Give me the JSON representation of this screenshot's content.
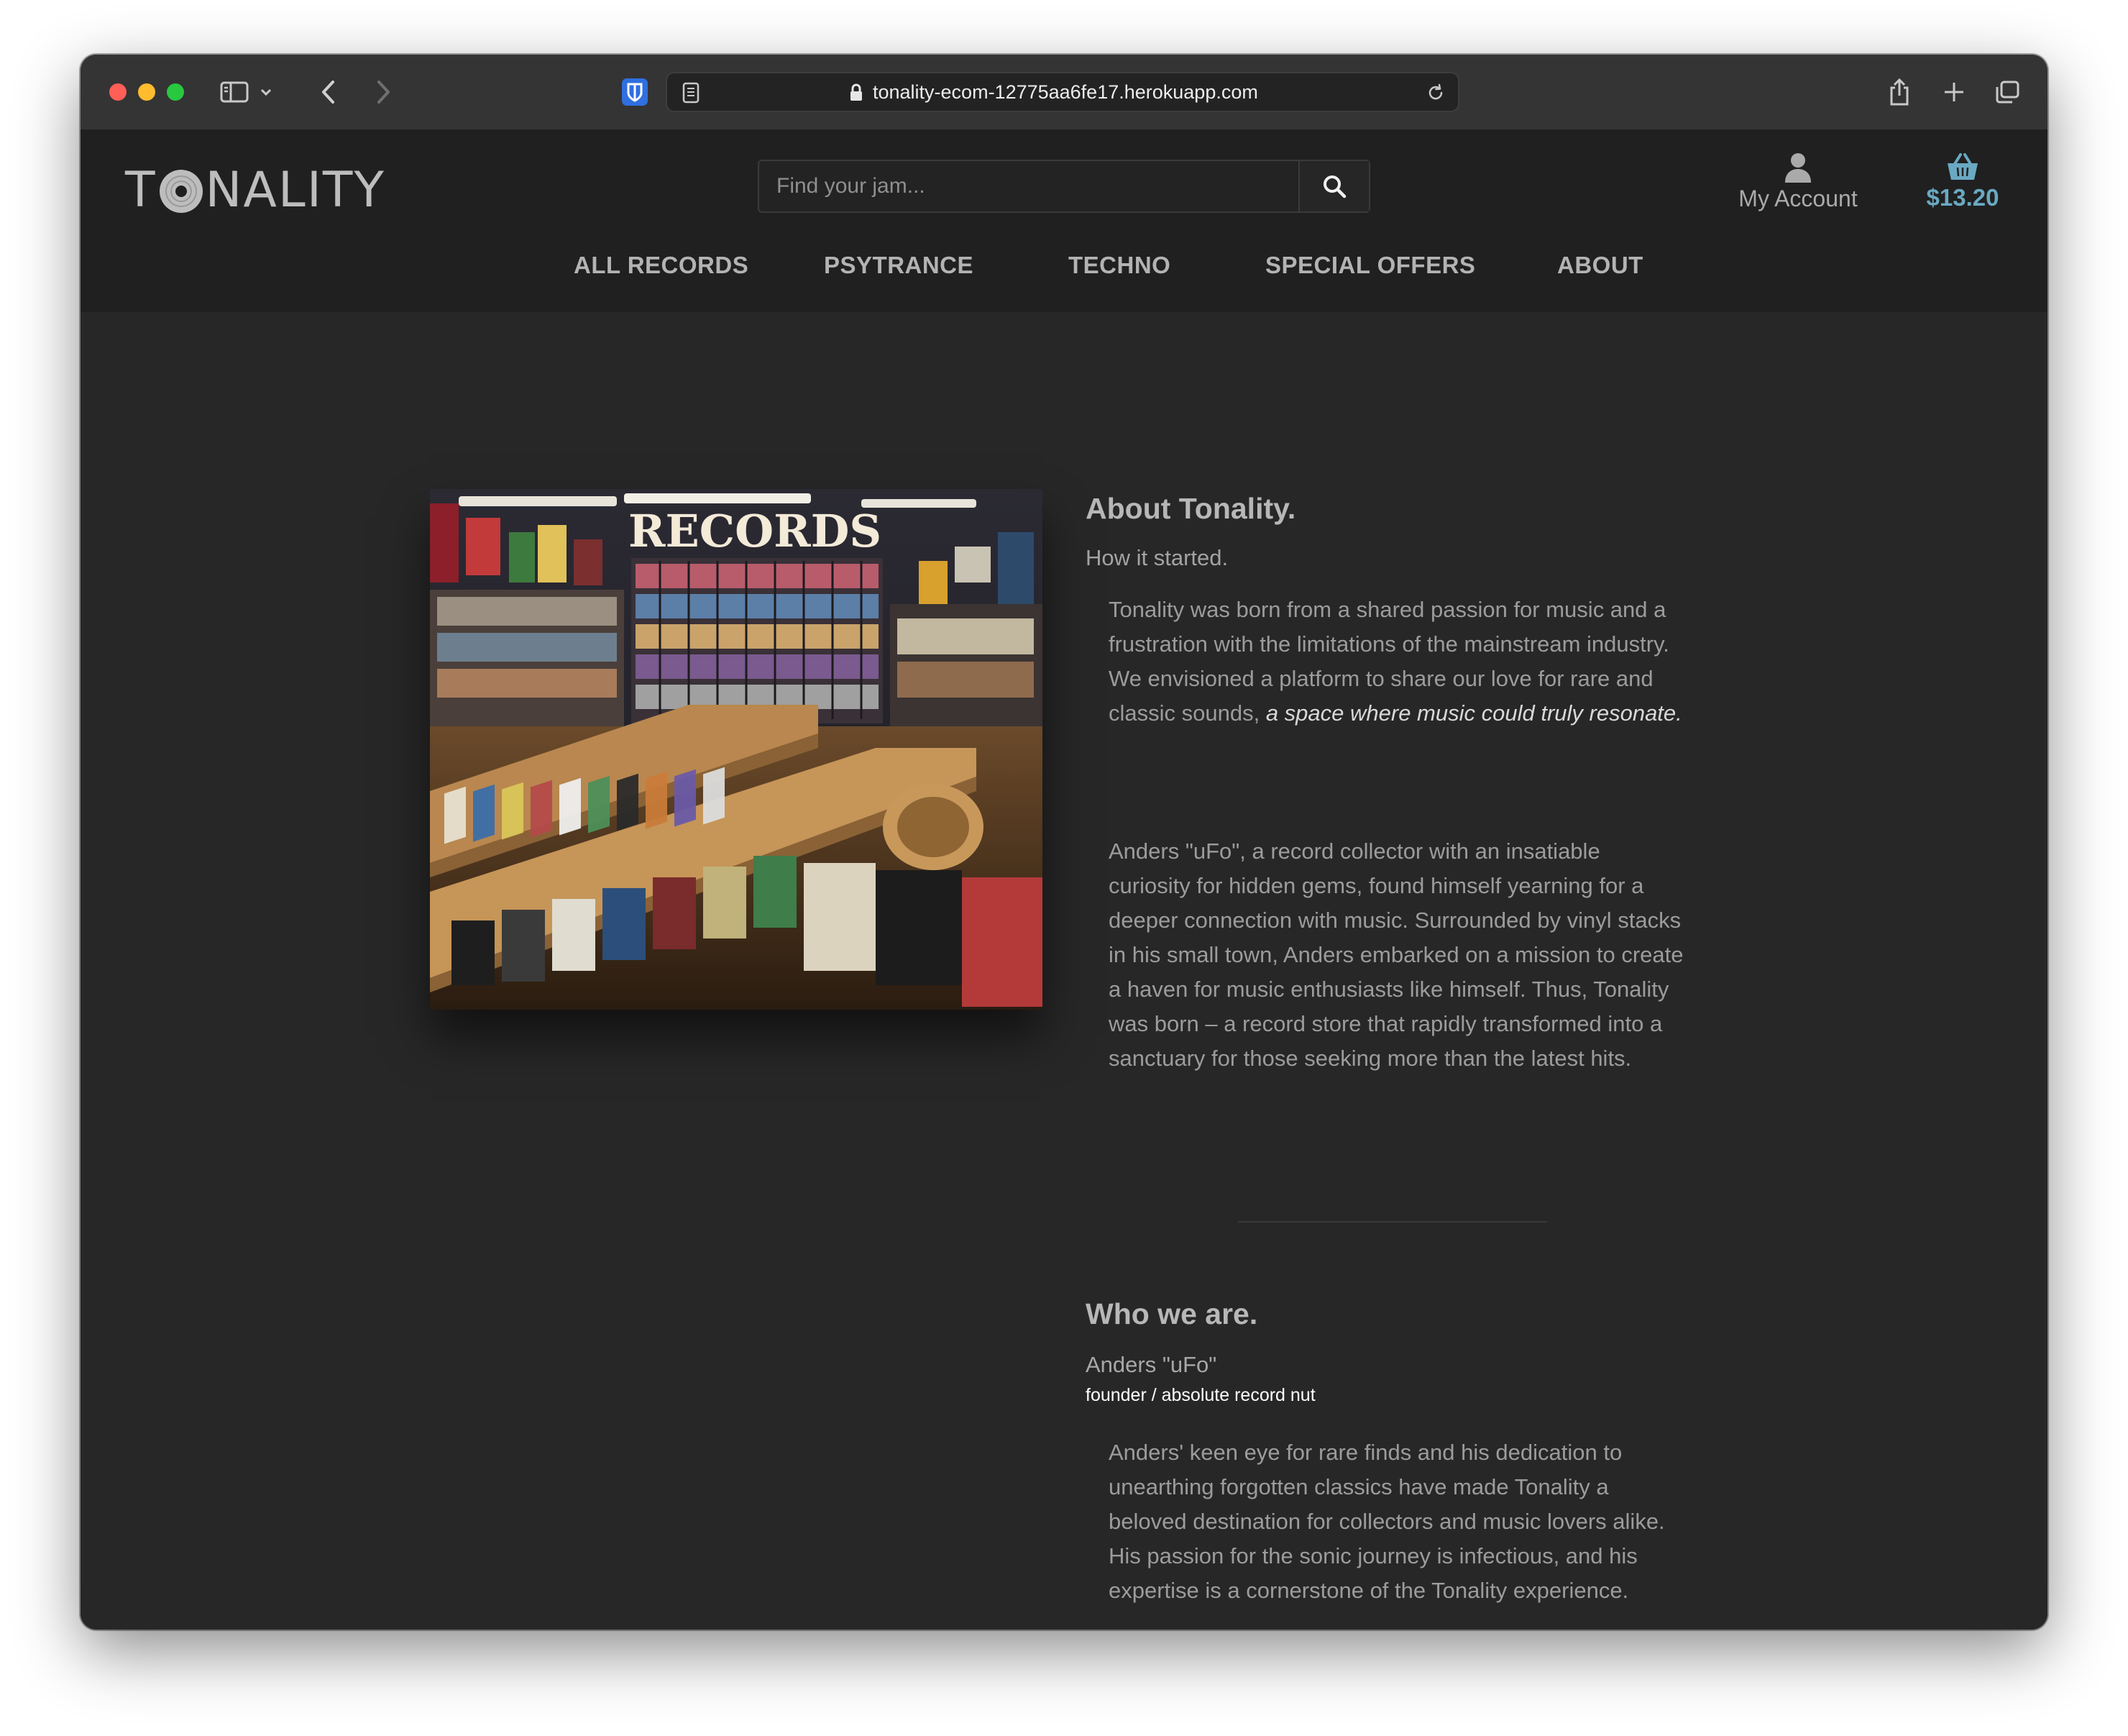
{
  "browser": {
    "url": "tonality-ecom-12775aa6fe17.herokuapp.com"
  },
  "site": {
    "logo_text": "TONALITY",
    "search": {
      "placeholder": "Find your jam...",
      "value": ""
    },
    "account_label": "My Account",
    "basket_total": "$13.20",
    "accent_color": "#6aa9c3",
    "nav": [
      {
        "label": "ALL RECORDS"
      },
      {
        "label": "PSYTRANCE"
      },
      {
        "label": "TECHNO"
      },
      {
        "label": "SPECIAL OFFERS"
      },
      {
        "label": "ABOUT"
      }
    ]
  },
  "about": {
    "image_sign": "RECORDS",
    "title": "About Tonality.",
    "subtitle": "How it started.",
    "para1_text": "Tonality was born from a shared passion for music and a frustration with the limitations of the mainstream industry. We envisioned a platform to share our love for rare and classic sounds, ",
    "para1_emphasis": "a space where music could truly resonate.",
    "para2": "Anders \"uFo\", a record collector with an insatiable curiosity for hidden gems, found himself yearning for a deeper connection with music. Surrounded by vinyl stacks in his small town, Anders embarked on a mission to create a haven for music enthusiasts like himself. Thus, Tonality was born – a record store that rapidly transformed into a sanctuary for those seeking more than the latest hits."
  },
  "team": {
    "title": "Who we are.",
    "member_name": "Anders \"uFo\"",
    "member_role": "founder / absolute record nut",
    "member_bio": "Anders' keen eye for rare finds and his dedication to unearthing forgotten classics have made Tonality a beloved destination for collectors and music lovers alike. His passion for the sonic journey is infectious, and his expertise is a cornerstone of the Tonality experience."
  }
}
